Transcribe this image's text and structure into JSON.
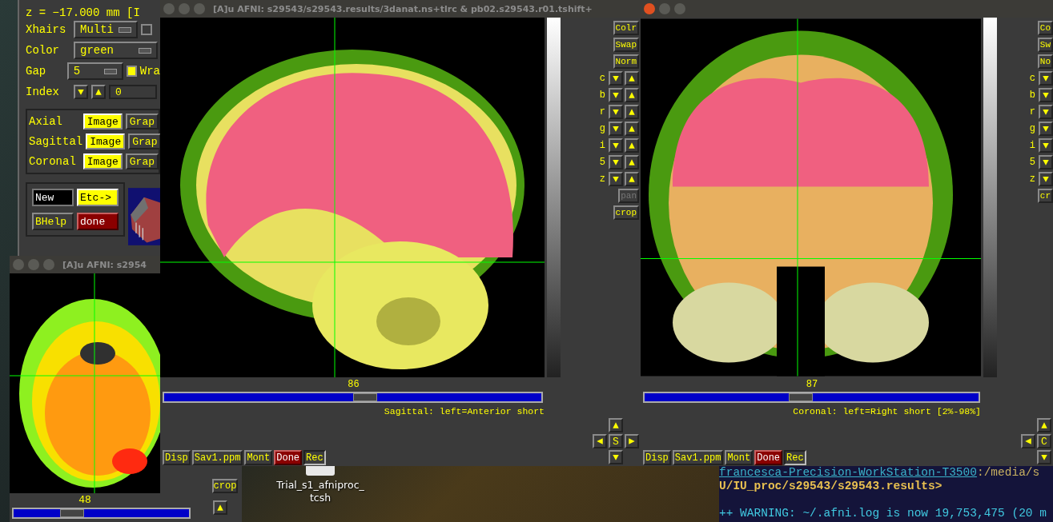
{
  "control_panel": {
    "coordinate": "z =  −17.000 mm [I",
    "rows": [
      {
        "label": "Xhairs",
        "kind": "dropdown",
        "value": "Multi",
        "checkbox": {
          "checked": false
        }
      },
      {
        "label": "Color",
        "kind": "dropdown",
        "value": "green"
      },
      {
        "label": "Gap",
        "kind": "dropdown",
        "value": "5",
        "checkbox": {
          "label": "Wra",
          "checked": true
        }
      },
      {
        "label": "Index",
        "kind": "spinner",
        "value": "0"
      }
    ],
    "views": [
      {
        "label": "Axial",
        "image": "Image",
        "graph": "Grap",
        "on": true
      },
      {
        "label": "Sagittal",
        "image": "Image",
        "graph": "Grap",
        "on": true
      },
      {
        "label": "Coronal",
        "image": "Image",
        "graph": "Grap",
        "on": true
      }
    ],
    "buttons": [
      {
        "label": "New",
        "kind": "dark"
      },
      {
        "label": "Etc->",
        "kind": "accent"
      },
      {
        "label": "BHelp",
        "kind": "plain"
      },
      {
        "label": "done",
        "kind": "danger"
      }
    ]
  },
  "axial_window": {
    "title": "[A]u AFNI: s2954",
    "slice": "48",
    "level": 0.3,
    "side_button": "crop"
  },
  "sagittal_window": {
    "title": "[A]u AFNI: s29543/s29543.results/3danat.ns+tlrc & pb02.s29543.r01.tshift+",
    "slice": "86",
    "level": 0.53,
    "caption": "Sagittal: left=Anterior short",
    "side_buttons": [
      "Colr",
      "Swap",
      "Norm"
    ],
    "channels": [
      "c",
      "b",
      "r",
      "g",
      "i",
      "5",
      "z"
    ],
    "extra_buttons": [
      {
        "label": "pan",
        "disabled": true
      },
      {
        "label": "crop",
        "disabled": false
      }
    ],
    "pad": {
      "label": "S"
    },
    "bottom_buttons": [
      {
        "label": "Disp",
        "kind": "plain"
      },
      {
        "label": "Sav1.ppm",
        "kind": "plain"
      },
      {
        "label": "Mont",
        "kind": "plain"
      },
      {
        "label": "Done",
        "kind": "danger"
      },
      {
        "label": "Rec",
        "kind": "pressed"
      }
    ]
  },
  "coronal_window": {
    "slice": "87",
    "level": 0.46,
    "caption": "Coronal: left=Right short [2%-98%]",
    "side_buttons": [
      "Co",
      "Sw",
      "No"
    ],
    "channels": [
      "c",
      "b",
      "r",
      "g",
      "i",
      "5",
      "z"
    ],
    "extra_buttons": [
      {
        "label": "cr",
        "disabled": false
      }
    ],
    "pad": {
      "label": "C"
    },
    "bottom_buttons": [
      {
        "label": "Disp",
        "kind": "plain"
      },
      {
        "label": "Sav1.ppm",
        "kind": "plain"
      },
      {
        "label": "Mont",
        "kind": "plain"
      },
      {
        "label": "Done",
        "kind": "danger"
      },
      {
        "label": "Rec",
        "kind": "pressed"
      }
    ]
  },
  "desktop_icon": {
    "label_lines": [
      "Trial_s1_afniproc_",
      "tcsh"
    ]
  },
  "terminal": {
    "host": "francesca-Precision-WorkStation-T3500",
    "path": ":/media/s",
    "prompt": "U/IU_proc/s29543/s29543.results>",
    "warning": "++ WARNING: ~/.afni.log is now 19,753,475 (20 m"
  }
}
